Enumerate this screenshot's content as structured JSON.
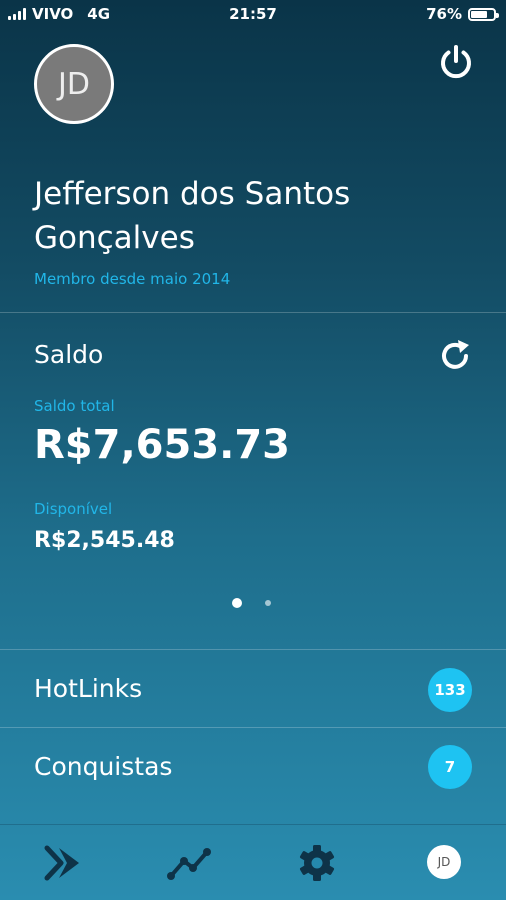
{
  "status_bar": {
    "carrier": "VIVO",
    "network": "4G",
    "time": "21:57",
    "battery": "76%",
    "battery_level": 0.76
  },
  "profile": {
    "initials": "JD",
    "name_line1": "Jefferson dos Santos",
    "name_line2": "Gonçalves",
    "member_since": "Membro desde maio 2014"
  },
  "balance": {
    "title": "Saldo",
    "total_label": "Saldo total",
    "total_value": "R$7,653.73",
    "available_label": "Disponível",
    "available_value": "R$2,545.48",
    "page_index": 0,
    "page_count": 2
  },
  "list": {
    "items": [
      {
        "label": "HotLinks",
        "count": "133"
      },
      {
        "label": "Conquistas",
        "count": "7"
      }
    ]
  },
  "tab_bar": {
    "items": [
      {
        "icon": "play-forward-icon"
      },
      {
        "icon": "trend-chart-icon"
      },
      {
        "icon": "gear-icon"
      },
      {
        "icon": "avatar"
      }
    ],
    "avatar_initials": "JD"
  },
  "colors": {
    "accent": "#21b6e8",
    "badge": "#1ec3f2",
    "tab_icon": "#0e3348"
  }
}
